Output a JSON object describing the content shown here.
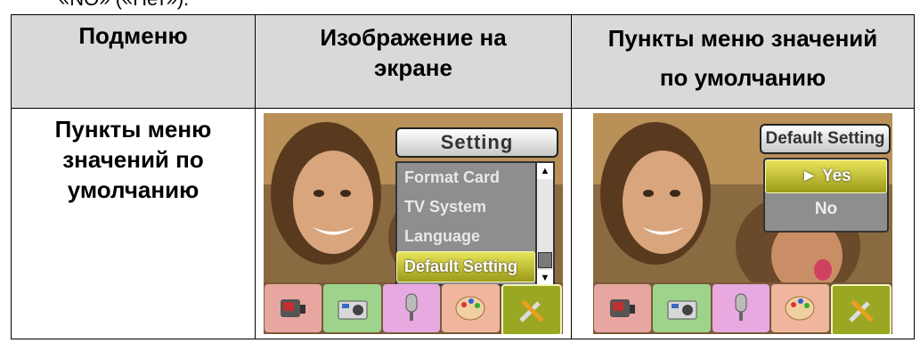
{
  "cut_text": "«NO» («Нет»).",
  "table": {
    "headers": {
      "submenu": "Подменю",
      "screen_line1": "Изображение на",
      "screen_line2": "экране",
      "defaults_line1": "Пункты меню значений",
      "defaults_line2": "по умолчанию"
    },
    "row": {
      "sub_line1": "Пункты меню",
      "sub_line2": "значений по",
      "sub_line3": "умолчанию"
    }
  },
  "screen1": {
    "title": "Setting",
    "items": [
      "Format Card",
      "TV System",
      "Language",
      "Default Setting"
    ],
    "selected_index": 3
  },
  "screen2": {
    "title": "Default Setting",
    "options": [
      "► Yes",
      "No"
    ],
    "selected_index": 0
  },
  "mode_icons": [
    "video-camera-icon",
    "camera-icon",
    "microphone-icon",
    "palette-icon",
    "tools-icon"
  ]
}
